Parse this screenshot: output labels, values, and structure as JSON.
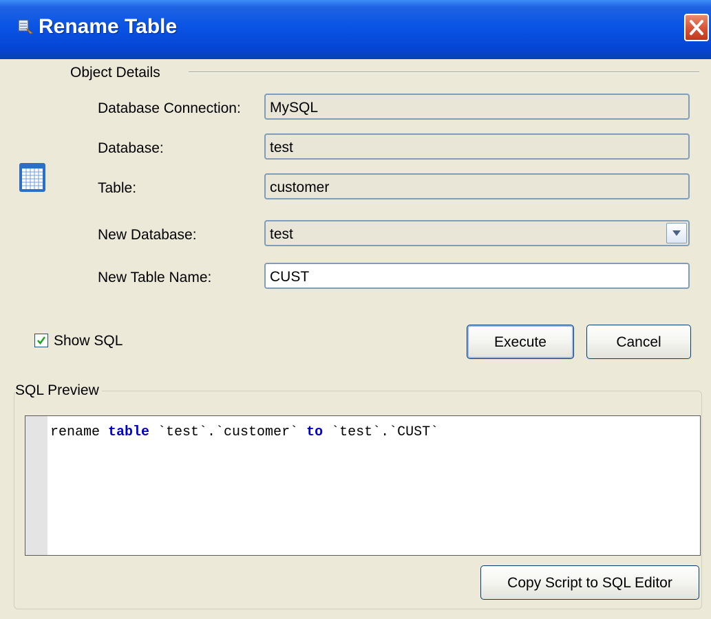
{
  "window": {
    "title": "Rename Table",
    "close_label": "✕"
  },
  "object_details": {
    "heading": "Object Details",
    "fields": [
      {
        "label": "Database Connection:",
        "value": "MySQL"
      },
      {
        "label": "Database:",
        "value": "test"
      },
      {
        "label": "Table:",
        "value": "customer"
      },
      {
        "label": "New Database:",
        "value": "test"
      },
      {
        "label": "New Table Name:",
        "value": "CUST"
      }
    ]
  },
  "show_sql": {
    "label": "Show SQL",
    "checked": true
  },
  "buttons": {
    "execute": "Execute",
    "cancel": "Cancel",
    "copy_script": "Copy Script to SQL Editor"
  },
  "sql_preview": {
    "heading": "SQL Preview",
    "tokens": [
      "rename ",
      "table",
      " `test`.`customer` ",
      "to",
      " `test`.`CUST`"
    ]
  },
  "colors": {
    "titlebar": "#0a54e5",
    "keyword": "#0000cc",
    "dialog_bg": "#ece9d8"
  },
  "icons": {
    "title": "table-window-icon",
    "close": "close-icon",
    "dropdown": "chevron-down-icon",
    "table": "table-grid-icon",
    "check": "checkmark-icon"
  }
}
